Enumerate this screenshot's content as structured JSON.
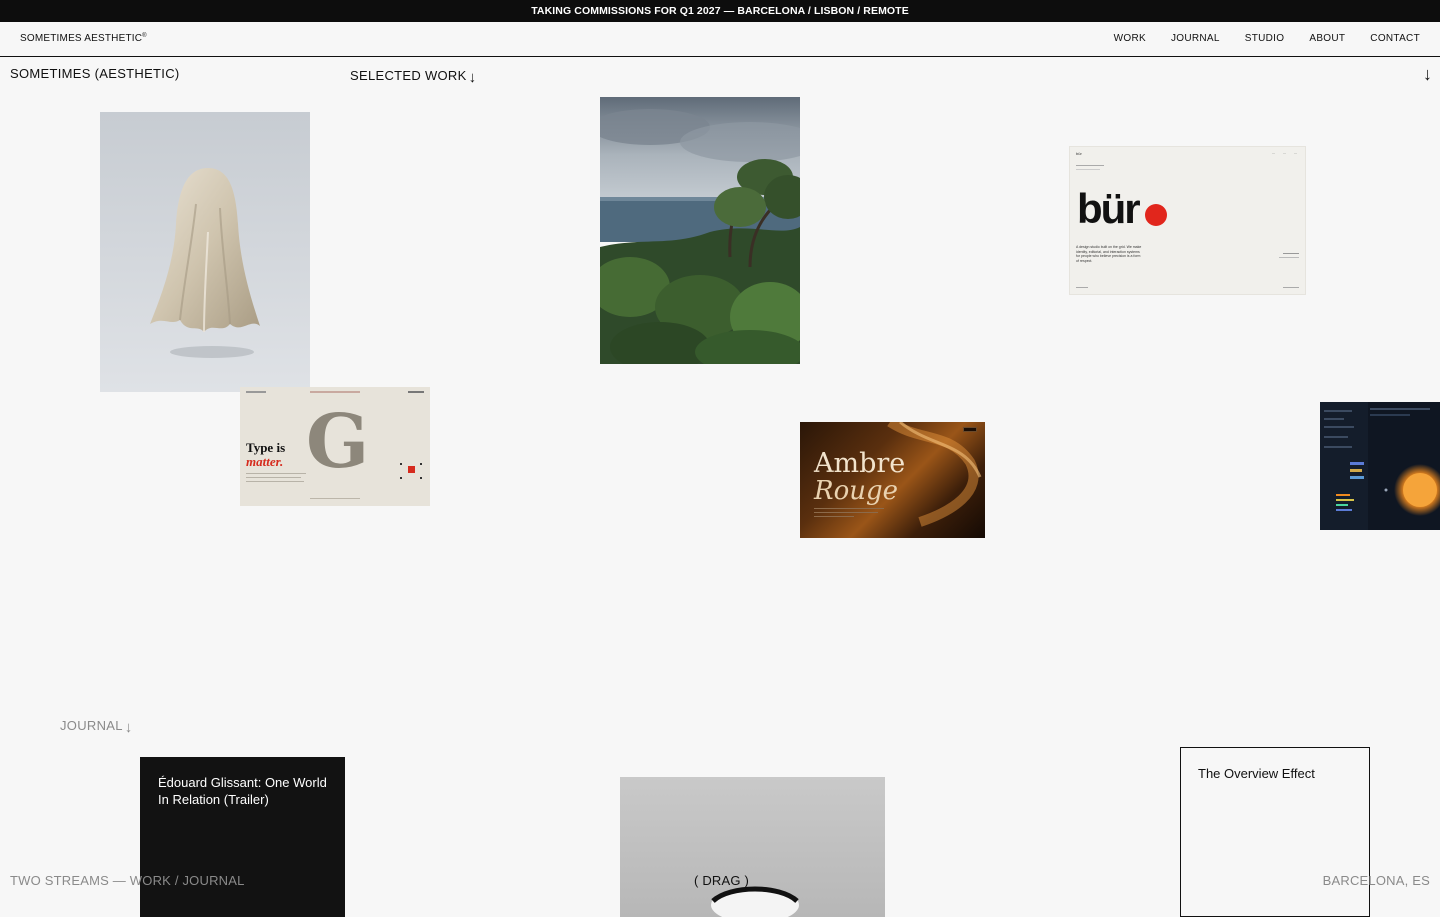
{
  "banner": {
    "text": "TAKING COMMISSIONS FOR Q1 2027 — BARCELONA / LISBON / REMOTE"
  },
  "nav": {
    "brand": "SOMETIMES AESTHETIC",
    "brand_mark": "®",
    "links": [
      "WORK",
      "JOURNAL",
      "STUDIO",
      "ABOUT",
      "CONTACT"
    ]
  },
  "header": {
    "site_title": "SOMETIMES (AESTHETIC)",
    "work_heading": "SELECTED WORK",
    "arrow": "↓"
  },
  "work": {
    "buro": {
      "logo": "bür",
      "nav_small": [
        "—",
        "—",
        "—"
      ],
      "tagline_lines": [
        "A design studio built on the grid. We make",
        "identity, editorial, and interaction systems",
        "for people who believe precision is a form",
        "of respect."
      ]
    },
    "type": {
      "headline_top": "Type is",
      "headline_accent": "matter.",
      "glyph": "G"
    },
    "ambre": {
      "title_1": "Ambre",
      "title_2": "Rouge"
    }
  },
  "journal": {
    "heading": "JOURNAL",
    "arrow": "↓",
    "card_dark_title": "Édouard Glissant: One World In Relation (Trailer)",
    "card_outline_title": "The Overview Effect"
  },
  "footer": {
    "left": "TWO STREAMS — WORK / JOURNAL",
    "center": "( DRAG )",
    "right": "BARCELONA, ES"
  },
  "colors": {
    "background": "#f7f7f7",
    "ink": "#111111",
    "muted": "#8a8a8a",
    "accent_red": "#e1261c"
  }
}
